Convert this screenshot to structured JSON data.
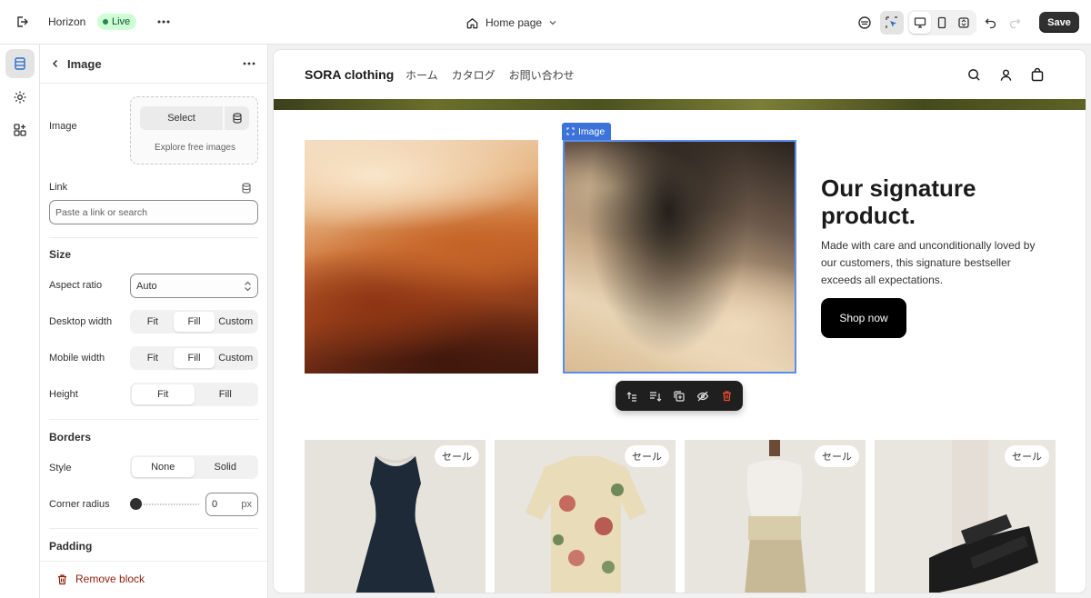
{
  "topbar": {
    "theme_name": "Horizon",
    "live_badge": "Live",
    "page_selector": "Home page",
    "save_label": "Save"
  },
  "panel": {
    "title": "Image",
    "image_label": "Image",
    "select_label": "Select",
    "explore_label": "Explore free images",
    "link_label": "Link",
    "link_placeholder": "Paste a link or search",
    "size_title": "Size",
    "aspect_ratio_label": "Aspect ratio",
    "aspect_ratio_value": "Auto",
    "desktop_width_label": "Desktop width",
    "desktop_width_options": [
      "Fit",
      "Fill",
      "Custom"
    ],
    "desktop_width_selected": "Fill",
    "mobile_width_label": "Mobile width",
    "mobile_width_options": [
      "Fit",
      "Fill",
      "Custom"
    ],
    "mobile_width_selected": "Fill",
    "height_label": "Height",
    "height_options": [
      "Fit",
      "Fill"
    ],
    "height_selected": "Fit",
    "borders_title": "Borders",
    "style_label": "Style",
    "style_options": [
      "None",
      "Solid"
    ],
    "style_selected": "None",
    "corner_radius_label": "Corner radius",
    "corner_radius_value": "0",
    "corner_radius_unit": "px",
    "padding_title": "Padding",
    "remove_label": "Remove block"
  },
  "store": {
    "logo": "SORA clothing",
    "nav": [
      "ホーム",
      "カタログ",
      "お問い合わせ"
    ],
    "image_tag": "Image",
    "headline": "Our signature product.",
    "description": "Made with care and unconditionally loved by our customers, this signature bestseller exceeds all expectations.",
    "cta": "Shop now",
    "products": [
      {
        "badge": "セール"
      },
      {
        "badge": "セール"
      },
      {
        "badge": "セール"
      },
      {
        "badge": "セール"
      }
    ]
  },
  "colors": {
    "accent_selection": "#5b8def",
    "live_badge_bg": "#cdfed4",
    "danger": "#8e1f0b",
    "primary_button": "#303030"
  }
}
